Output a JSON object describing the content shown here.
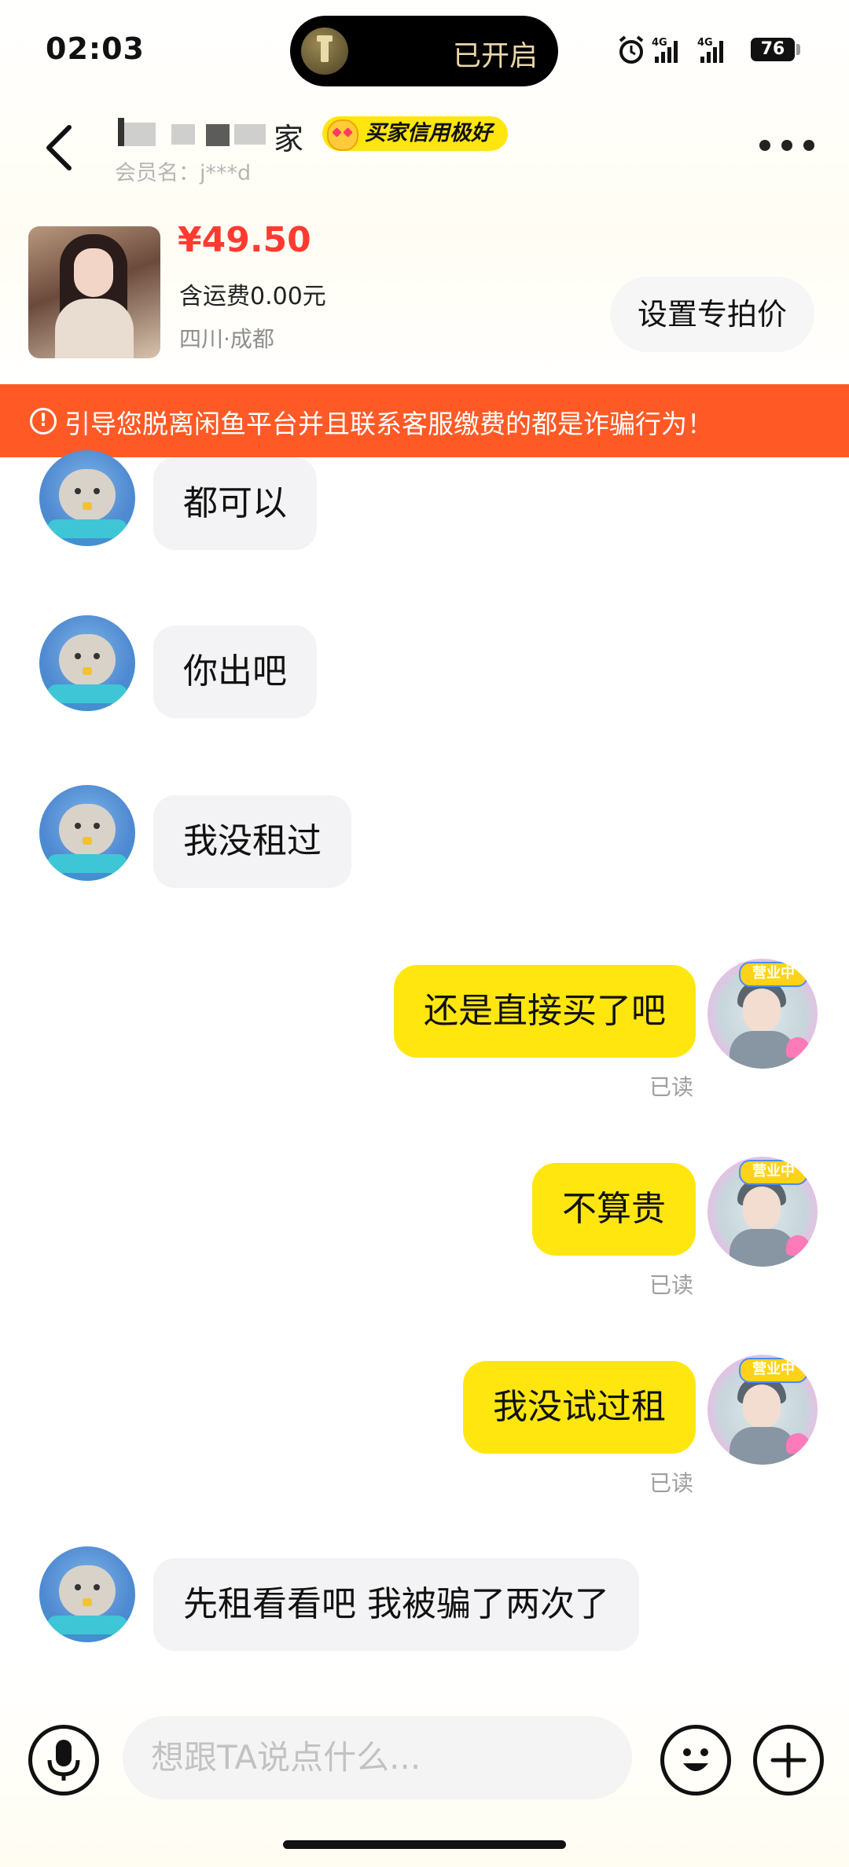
{
  "status_bar": {
    "time": "02:03",
    "island_text": "已开启",
    "network_1": "4G",
    "network_2": "4G",
    "battery": "76"
  },
  "header": {
    "seller_name": "家",
    "credit_badge": "买家信用极好",
    "member_label": "会员名：j***d"
  },
  "product": {
    "price": "¥49.50",
    "shipping": "含运费0.00元",
    "location": "四川·成都",
    "special_price_button": "设置专拍价"
  },
  "warning": {
    "icon": "!",
    "text": "引导您脱离闲鱼平台并且联系客服缴费的都是诈骗行为！"
  },
  "messages": [
    {
      "side": "left",
      "text": "都可以"
    },
    {
      "side": "left",
      "text": "你出吧"
    },
    {
      "side": "left",
      "text": "我没租过"
    },
    {
      "side": "right",
      "text": "还是直接买了吧",
      "status": "已读"
    },
    {
      "side": "right",
      "text": "不算贵",
      "status": "已读"
    },
    {
      "side": "right",
      "text": "我没试过租",
      "status": "已读"
    },
    {
      "side": "left",
      "text": "先租看看吧 我被骗了两次了"
    }
  ],
  "avatar_tag": "营业中",
  "input": {
    "placeholder": "想跟TA说点什么..."
  },
  "colors": {
    "accent_yellow": "#ffe60f",
    "price_red": "#ff3b30",
    "warning_orange": "#ff5a26"
  }
}
